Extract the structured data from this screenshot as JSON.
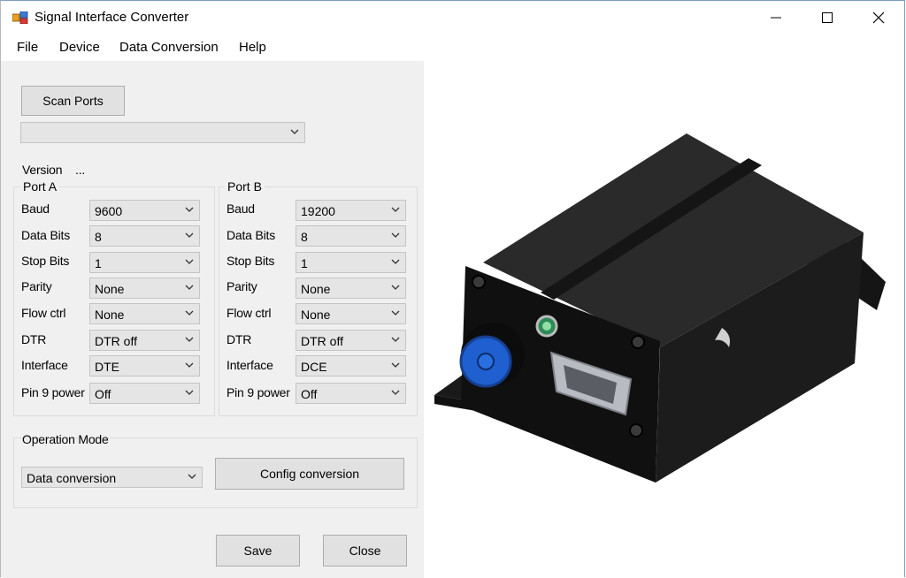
{
  "window": {
    "title": "Signal Interface Converter"
  },
  "menu": [
    "File",
    "Device",
    "Data Conversion",
    "Help"
  ],
  "scan_ports_label": "Scan Ports",
  "port_select_value": "",
  "version": {
    "label": "Version",
    "value": "..."
  },
  "port_a": {
    "title": "Port A",
    "fields": [
      {
        "label": "Baud",
        "value": "9600"
      },
      {
        "label": "Data Bits",
        "value": "8"
      },
      {
        "label": "Stop Bits",
        "value": "1"
      },
      {
        "label": "Parity",
        "value": "None"
      },
      {
        "label": "Flow ctrl",
        "value": "None"
      },
      {
        "label": "DTR",
        "value": "DTR off"
      },
      {
        "label": "Interface",
        "value": "DTE"
      },
      {
        "label": "Pin 9 power",
        "value": "Off"
      }
    ]
  },
  "port_b": {
    "title": "Port B",
    "fields": [
      {
        "label": "Baud",
        "value": "19200"
      },
      {
        "label": "Data Bits",
        "value": "8"
      },
      {
        "label": "Stop Bits",
        "value": "1"
      },
      {
        "label": "Parity",
        "value": "None"
      },
      {
        "label": "Flow ctrl",
        "value": "None"
      },
      {
        "label": "DTR",
        "value": "DTR off"
      },
      {
        "label": "Interface",
        "value": "DCE"
      },
      {
        "label": "Pin 9 power",
        "value": "Off"
      }
    ]
  },
  "operation_mode": {
    "title": "Operation Mode",
    "value": "Data conversion",
    "config_button": "Config conversion"
  },
  "buttons": {
    "save": "Save",
    "close": "Close"
  },
  "icons": [
    "app-icon",
    "minimize-icon",
    "maximize-icon",
    "close-icon",
    "chevron-down-icon"
  ],
  "colors": {
    "title_bar": "#ffffff",
    "client_bg": "#f0f0f0",
    "button_bg": "#e1e1e1",
    "device_body": "#1c1c1c",
    "connector_blue": "#1f5fd0"
  }
}
